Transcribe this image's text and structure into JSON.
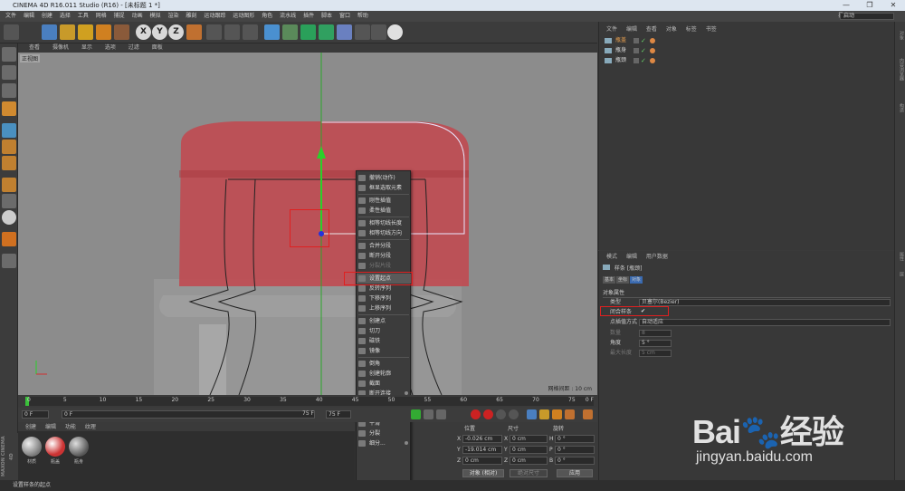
{
  "window": {
    "title": "CINEMA 4D R16.011 Studio (R16) - [未标题 1 *]",
    "min": "—",
    "max": "❐",
    "close": "✕"
  },
  "menubar": {
    "items": [
      "文件",
      "编辑",
      "创建",
      "选择",
      "工具",
      "网格",
      "捕捉",
      "动画",
      "模拟",
      "渲染",
      "雕刻",
      "运动跟踪",
      "运动图形",
      "角色",
      "流水线",
      "插件",
      "脚本",
      "窗口",
      "帮助"
    ],
    "layout_label": "界面:",
    "layout_value": "启动"
  },
  "viewport": {
    "menu": [
      "查看",
      "摄像机",
      "显示",
      "选项",
      "过滤",
      "面板"
    ],
    "title": "正视图",
    "grid_spacing": "网格间距 : 10 cm"
  },
  "context_menu": {
    "items": [
      {
        "label": "撤销(动作)",
        "state": "normal"
      },
      {
        "label": "框显选取元素",
        "state": "normal"
      },
      {
        "sep": true
      },
      {
        "label": "刚性插值",
        "state": "normal"
      },
      {
        "label": "柔性插值",
        "state": "normal"
      },
      {
        "sep": true
      },
      {
        "label": "相等切线长度",
        "state": "normal"
      },
      {
        "label": "相等切线方向",
        "state": "normal"
      },
      {
        "sep": true
      },
      {
        "label": "合并分段",
        "state": "normal"
      },
      {
        "label": "断开分段",
        "state": "normal"
      },
      {
        "label": "分裂片段",
        "state": "disabled"
      },
      {
        "sep": true
      },
      {
        "label": "设置起点",
        "state": "highlight"
      },
      {
        "label": "反转序列",
        "state": "normal"
      },
      {
        "label": "下移序列",
        "state": "normal"
      },
      {
        "label": "上移序列",
        "state": "normal"
      },
      {
        "sep": true
      },
      {
        "label": "创建点",
        "state": "normal"
      },
      {
        "label": "切刀",
        "state": "normal"
      },
      {
        "label": "磁铁",
        "state": "normal"
      },
      {
        "label": "镜像",
        "state": "normal"
      },
      {
        "sep": true
      },
      {
        "label": "倒角",
        "state": "normal"
      },
      {
        "label": "创建轮廓",
        "state": "normal"
      },
      {
        "label": "截面",
        "state": "normal"
      },
      {
        "label": "断开连接",
        "state": "normal",
        "sub": true
      },
      {
        "label": "排齐",
        "state": "disabled"
      },
      {
        "label": "投射样条",
        "state": "normal"
      },
      {
        "label": "平滑",
        "state": "normal"
      },
      {
        "label": "分裂",
        "state": "normal"
      },
      {
        "label": "细分...",
        "state": "normal",
        "sub": true
      }
    ]
  },
  "timeline": {
    "ticks": [
      "0",
      "5",
      "10",
      "15",
      "20",
      "25",
      "30",
      "35",
      "40",
      "45",
      "50",
      "55",
      "60",
      "65",
      "70",
      "75"
    ],
    "end_frame": "0 F",
    "start_field": "0 F",
    "mid_field": "0 F",
    "end_field": "75 F",
    "end_field2": "75 F"
  },
  "materials": {
    "menu": [
      "创建",
      "编辑",
      "功能",
      "纹理"
    ],
    "items": [
      {
        "label": "材质",
        "color": "#b0b0b0"
      },
      {
        "label": "瓶盖",
        "color": "#cc3333"
      },
      {
        "label": "瓶身",
        "color": "#9a9a9a"
      }
    ],
    "brand": "MAXON CINEMA 4D"
  },
  "coordinates": {
    "headers": [
      "位置",
      "尺寸",
      "旋转"
    ],
    "rows": [
      {
        "axis": "X",
        "pos": "-0.026 cm",
        "size_axis": "X",
        "size": "0 cm",
        "rot_axis": "H",
        "rot": "0 °"
      },
      {
        "axis": "Y",
        "pos": "-19.014 cm",
        "size_axis": "Y",
        "size": "0 cm",
        "rot_axis": "P",
        "rot": "0 °"
      },
      {
        "axis": "Z",
        "pos": "0 cm",
        "size_axis": "Z",
        "size": "0 cm",
        "rot_axis": "B",
        "rot": "0 °"
      }
    ],
    "mode": "对象 (相对)",
    "size_mode": "绝对尺寸",
    "apply": "应用"
  },
  "object_manager": {
    "menu": [
      "文件",
      "编辑",
      "查看",
      "对象",
      "标签",
      "书签"
    ],
    "objects": [
      "瓶盖",
      "瓶身",
      "瓶颈"
    ]
  },
  "attributes": {
    "menu": [
      "模式",
      "编辑",
      "用户数据"
    ],
    "object_title": "样条 [瓶颈]",
    "tabs": [
      "基本",
      "坐标",
      "对象"
    ],
    "section": "对象属性",
    "rows": [
      {
        "label": "类型",
        "value": "贝塞尔(Bezier)",
        "disabled": false
      },
      {
        "label": "闭合样条",
        "value": "✔",
        "disabled": false
      },
      {
        "label": "点插值方式",
        "value": "自动适应",
        "disabled": false
      },
      {
        "label": "数量",
        "value": "8",
        "disabled": true
      },
      {
        "label": "角度",
        "value": "5 °",
        "disabled": false
      },
      {
        "label": "最大长度",
        "value": "5 cm",
        "disabled": true
      }
    ]
  },
  "right_tabs": [
    "对象",
    "内容浏览器",
    "构造",
    "属性",
    "层"
  ],
  "status": "设置样条的起点",
  "watermark": {
    "logo": "Bai🐾经验",
    "url": "jingyan.baidu.com"
  },
  "colors": {
    "accent": "#e02020",
    "viewport": "#8c8c8c",
    "cap": "#c3464e"
  }
}
